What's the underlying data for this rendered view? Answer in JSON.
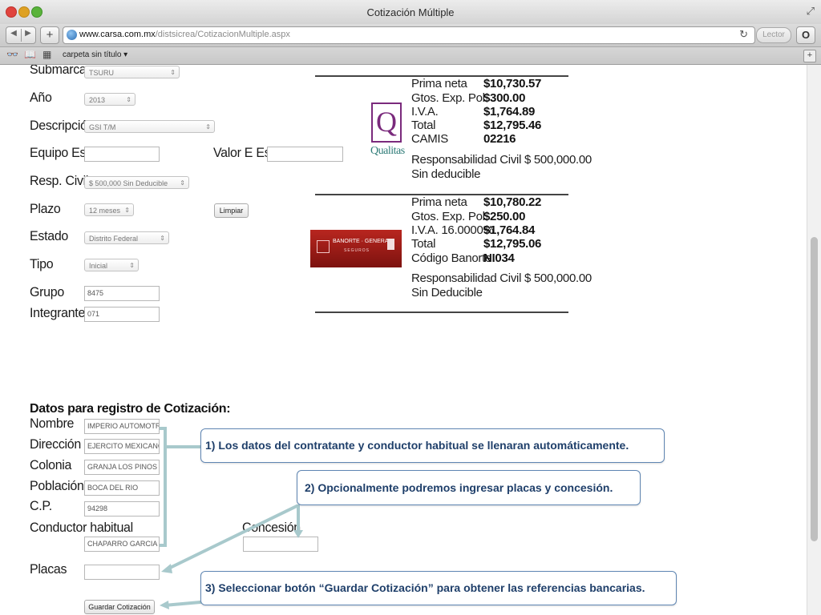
{
  "window": {
    "title": "Cotización Múltiple"
  },
  "toolbar": {
    "url_host": "www.carsa.com.mx",
    "url_path": "/distsicrea/CotizacionMultiple.aspx",
    "reader_label": "Lector",
    "back_icon": "back-arrow-icon",
    "forward_icon": "forward-arrow-icon"
  },
  "bookmarks": {
    "folder_label": "carpeta sin título ▾"
  },
  "form": {
    "submarca_label": "Submarca",
    "submarca_value": "TSURU",
    "anio_label": "Año",
    "anio_value": "2013",
    "descripcion_label": "Descripción",
    "descripcion_value": "GSI T/M",
    "equipo_label": "Equipo Esp.",
    "equipo_value": "",
    "valor_label": "Valor E Esp",
    "valor_value": "",
    "resp_label": "Resp. Civil",
    "resp_value": "$ 500,000 Sin Deducible",
    "plazo_label": "Plazo",
    "plazo_value": "12 meses",
    "limpiar_label": "Limpiar",
    "estado_label": "Estado",
    "estado_value": "Distrito Federal",
    "tipo_label": "Tipo",
    "tipo_value": "Inicial",
    "grupo_label": "Grupo",
    "grupo_value": "8475",
    "integrante_label": "Integrante",
    "integrante_value": "071"
  },
  "quotes": [
    {
      "logo_text": "Qualitas",
      "logo_letter": "Q",
      "rows": [
        {
          "label": "Prima neta",
          "value": "$10,730.57"
        },
        {
          "label": "Gtos. Exp. Pol.",
          "value": "$300.00"
        },
        {
          "label": "I.V.A.",
          "value": "$1,764.89"
        },
        {
          "label": "Total",
          "value": "$12,795.46"
        },
        {
          "label": "CAMIS",
          "value": "02216"
        }
      ],
      "responsabilidad": "Responsabilidad Civil $ 500,000.00",
      "deducible": "Sin deducible"
    },
    {
      "logo_text": "BANORTE · GENERALI",
      "logo_sub": "SEGUROS",
      "rows": [
        {
          "label": "Prima neta",
          "value": "$10,780.22"
        },
        {
          "label": "Gtos. Exp. Pol.",
          "value": "$250.00"
        },
        {
          "label": "I.V.A. 16.0000%",
          "value": "$1,764.84"
        },
        {
          "label": "Total",
          "value": "$12,795.06"
        },
        {
          "label": "Código Banorte",
          "value": "NI034"
        }
      ],
      "responsabilidad": "Responsabilidad Civil $ 500,000.00",
      "deducible": "Sin Deducible"
    }
  ],
  "registro": {
    "title": "Datos para registro de Cotización:",
    "nombre_label": "Nombre",
    "nombre_value": "IMPERIO AUTOMOTRIZ",
    "direccion_label": "Dirección",
    "direccion_value": "EJERCITO MEXICANO S",
    "colonia_label": "Colonia",
    "colonia_value": "GRANJA LOS PINOS",
    "poblacion_label": "Población",
    "poblacion_value": "BOCA DEL RIO",
    "cp_label": "C.P.",
    "cp_value": "94298",
    "conductor_label": "Conductor habitual",
    "conductor_value": "CHAPARRO GARCIA AI",
    "concesion_label": "Concesión",
    "concesion_value": "",
    "placas_label": "Placas",
    "placas_value": "",
    "guardar_label": "Guardar Cotización"
  },
  "callouts": {
    "c1": "1) Los datos del contratante y conductor habitual se llenaran automáticamente.",
    "c2": "2) Opcionalmente podremos ingresar placas y concesión.",
    "c3": "3) Seleccionar botón “Guardar Cotización” para obtener las referencias bancarias."
  },
  "colors": {
    "callout_text": "#1f3f6a",
    "callout_border": "#5f86b3",
    "arrow": "#a8c9cc",
    "qualitas": "#7a2a7c",
    "banorte": "#a31d18"
  }
}
